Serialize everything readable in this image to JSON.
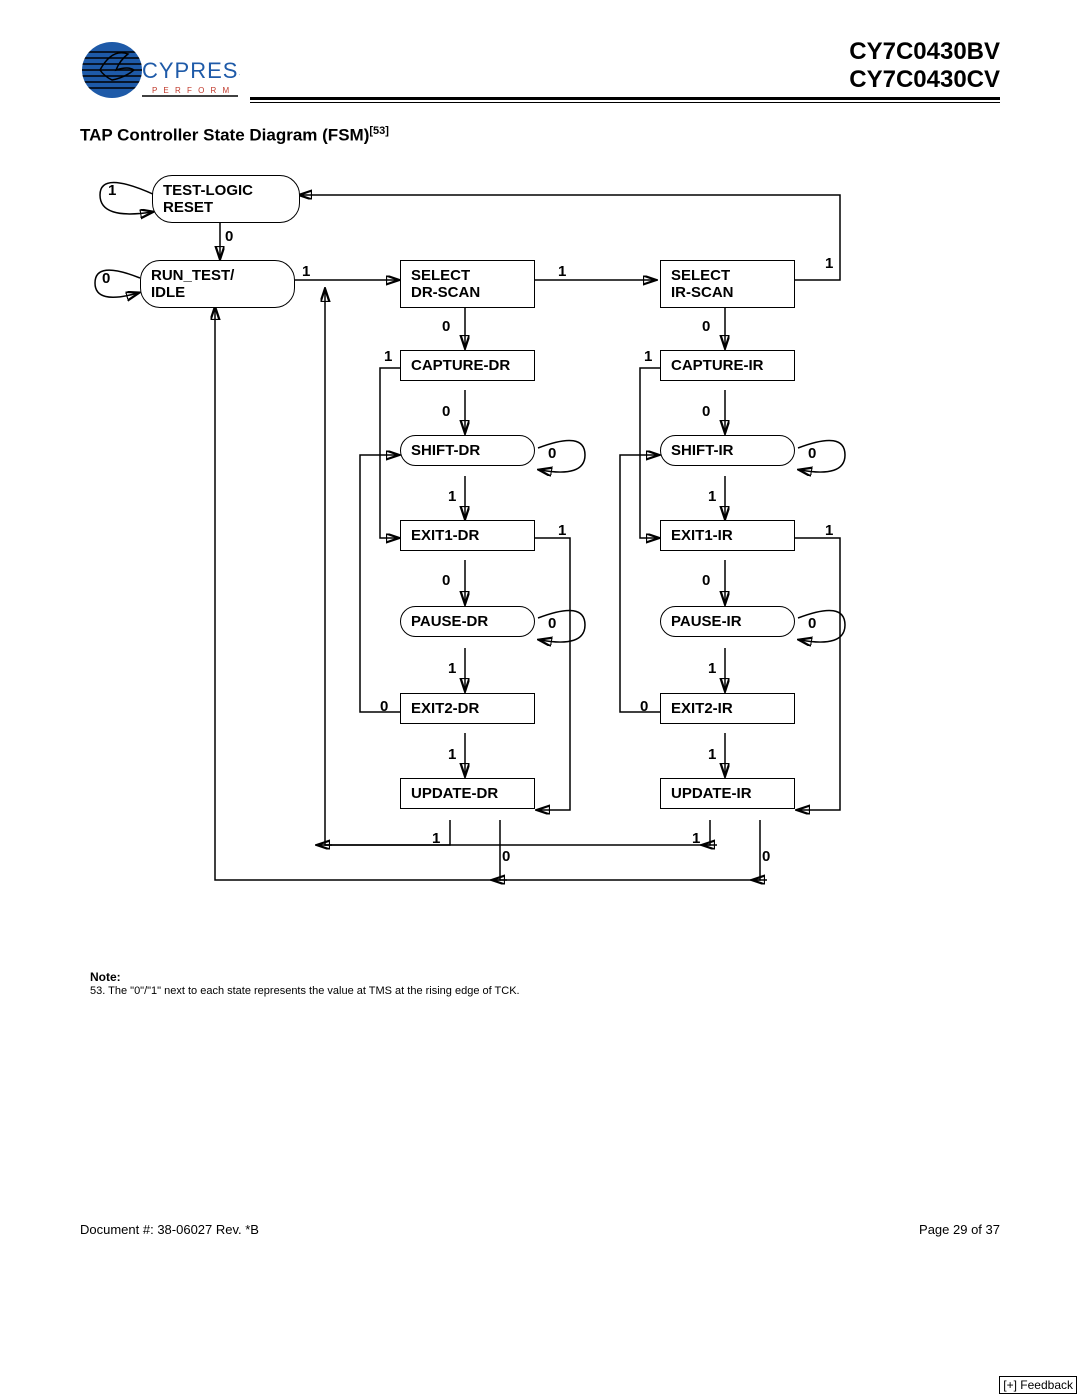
{
  "header": {
    "company_name": "CYPRESS",
    "company_tagline": "P E R F O R M",
    "part1": "CY7C0430BV",
    "part2": "CY7C0430CV"
  },
  "section": {
    "title": "TAP Controller State Diagram (FSM)",
    "footnote_ref": "[53]"
  },
  "diagram": {
    "states": {
      "tlr": "TEST-LOGIC\nRESET",
      "rti": "RUN_TEST/\nIDLE",
      "seldr": "SELECT\nDR-SCAN",
      "selir": "SELECT\nIR-SCAN",
      "capdr": "CAPTURE-DR",
      "capir": "CAPTURE-IR",
      "shfdr": "SHIFT-DR",
      "shfir": "SHIFT-IR",
      "ex1dr": "EXIT1-DR",
      "ex1ir": "EXIT1-IR",
      "psdr": "PAUSE-DR",
      "psir": "PAUSE-IR",
      "ex2dr": "EXIT2-DR",
      "ex2ir": "EXIT2-IR",
      "upddr": "UPDATE-DR",
      "updir": "UPDATE-IR"
    },
    "edge_labels": {
      "tlr_self": "1",
      "tlr_to_rti": "0",
      "rti_self": "0",
      "rti_to_seldr": "1",
      "seldr_to_selir": "1",
      "selir_to_tlr": "1",
      "seldr_to_cap": "0",
      "selir_to_cap": "0",
      "capdr_to_ex1": "1",
      "capir_to_ex1": "1",
      "capdr_to_shf": "0",
      "capir_to_shf": "0",
      "shfdr_self": "0",
      "shfir_self": "0",
      "shfdr_to_ex1": "1",
      "shfir_to_ex1": "1",
      "ex1dr_to_upd": "1",
      "ex1ir_to_upd": "1",
      "ex1dr_to_ps": "0",
      "ex1ir_to_ps": "0",
      "psdr_self": "0",
      "psir_self": "0",
      "psdr_to_ex2": "1",
      "psir_to_ex2": "1",
      "ex2dr_to_shf": "0",
      "ex2ir_to_shf": "0",
      "ex2dr_to_upd": "1",
      "ex2ir_to_upd": "1",
      "upddr_to_seldr": "1",
      "updir_to_seldr": "1",
      "upddr_to_rti": "0",
      "updir_to_rti": "0"
    }
  },
  "note": {
    "title": "Note:",
    "text": "53. The \"0\"/\"1\" next to each state represents the value at TMS at the rising edge of TCK."
  },
  "footer": {
    "doc": "Document #: 38-06027 Rev. *B",
    "page": "Page 29 of 37",
    "feedback": "[+] Feedback"
  }
}
